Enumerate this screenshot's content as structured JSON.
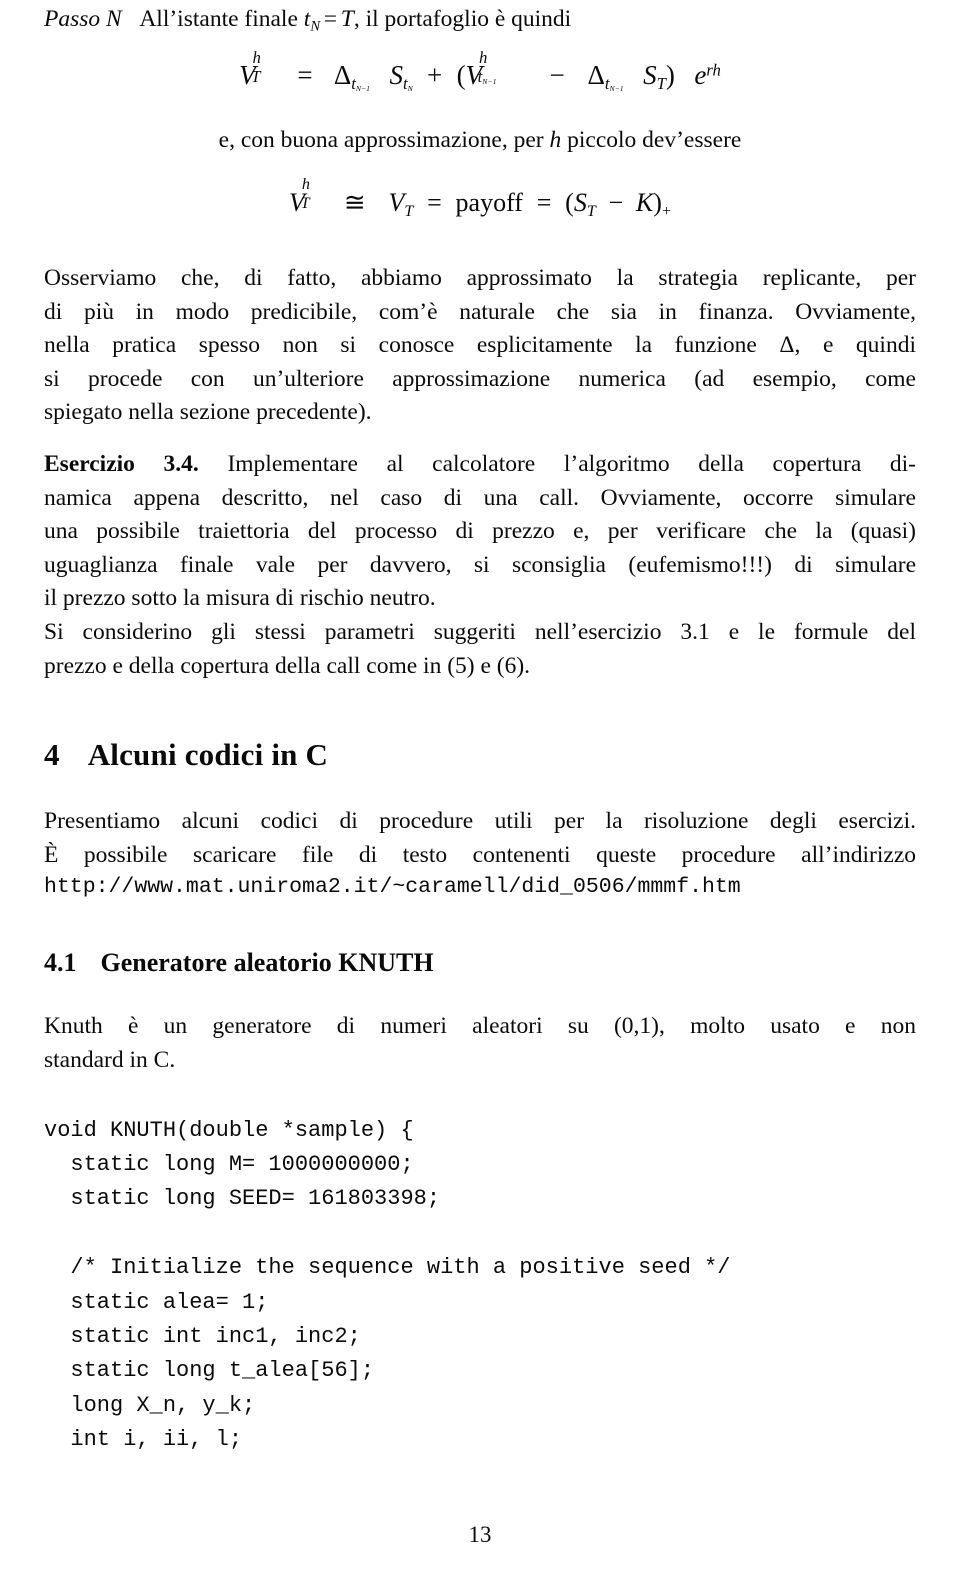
{
  "document": {
    "language": "it",
    "page_number": "13",
    "step_heading": {
      "label": "Passo N",
      "text": "All’istante finale t_N = T, il portafoglio è quindi",
      "text_plain": "All’istante finale",
      "text_tail": ", il portafoglio è quindi"
    },
    "formula_1": {
      "latex": "V_T^h = \\Delta_{t_{N-1}} S_{t_N} + (V_{t_{N-1}}^h - \\Delta_{t_{N-1}} S_T) e^{rh}",
      "parts": {
        "V": "V",
        "T": "T",
        "h": "h",
        "eq": "=",
        "Delta": "Δ",
        "t": "t",
        "N_minus_1": "N−1",
        "S": "S",
        "N": "N",
        "plus": "+",
        "lparen": "(",
        "minus": "−",
        "rparen": ")",
        "e": "e",
        "rh": "rh"
      }
    },
    "interline_text": {
      "before": "e, con buona approssimazione, per",
      "math_h": "h",
      "after": "piccolo dev’essere"
    },
    "formula_2": {
      "latex": "V_T^h \\cong V_T = \\mathrm{payoff} = (S_T - K)_+",
      "parts": {
        "V": "V",
        "T": "T",
        "h": "h",
        "cong": "≅",
        "eq": "=",
        "payoff": "payoff",
        "lparen": "(",
        "S": "S",
        "minus": "−",
        "K": "K",
        "rparen": ")",
        "plus_sub": "+"
      }
    },
    "paragraph_osserviamo": {
      "lines": [
        "Osserviamo che, di fatto, abbiamo approssimato la strategia replicante, per",
        "di più in modo predicibile, com’è naturale che sia in finanza. Ovviamente,",
        "nella pratica spesso non si conosce esplicitamente la funzione Δ, e quindi",
        "si procede con un’ulteriore approssimazione numerica (ad esempio, come",
        "spiegato nella sezione precedente)."
      ]
    },
    "esercizio": {
      "label": "Esercizio 3.4.",
      "lines": [
        "Implementare al calcolatore l’algoritmo della copertura di-",
        "namica appena descritto, nel caso di una call. Ovviamente, occorre simulare",
        "una possibile traiettoria del processo di prezzo e, per verificare che la (quasi)",
        "uguaglianza finale vale per davvero, si sconsiglia (eufemismo!!!) di simulare",
        "il prezzo sotto la misura di rischio neutro.",
        "Si considerino gli stessi parametri suggeriti nell’esercizio 3.1 e le formule del",
        "prezzo e della copertura della call come in (5) e (6)."
      ]
    },
    "section": {
      "number": "4",
      "title": "Alcuni codici in C"
    },
    "paragraph_presentiamo": {
      "lines": [
        "Presentiamo alcuni codici di procedure utili per la risoluzione degli esercizi.",
        "È possibile scaricare file di testo contenenti queste procedure all’indirizzo"
      ]
    },
    "url": "http://www.mat.uniroma2.it/~caramell/did_0506/mmmf.htm",
    "subsection": {
      "number": "4.1",
      "title": "Generatore aleatorio KNUTH"
    },
    "paragraph_knuth": {
      "lines": [
        "Knuth è un generatore di numeri aleatori su (0,1), molto usato e non",
        "standard in C."
      ]
    },
    "code_block": {
      "lines": [
        "void KNUTH(double *sample) {",
        "  static long M= 1000000000;",
        "  static long SEED= 161803398;",
        "",
        "  /* Initialize the sequence with a positive seed */",
        "  static alea= 1;",
        "  static int inc1, inc2;",
        "  static long t_alea[56];",
        "  long X_n, y_k;",
        "  int i, ii, l;"
      ]
    }
  }
}
